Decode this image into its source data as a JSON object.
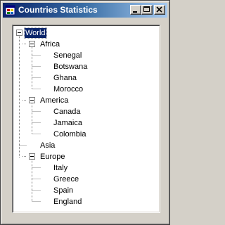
{
  "window": {
    "title": "Countries Statistics",
    "icon": "app-form-icon",
    "buttons": {
      "minimize": "minimize-icon",
      "maximize": "maximize-icon",
      "close": "close-icon"
    }
  },
  "tree": {
    "root": {
      "label": "World",
      "expanded": true,
      "selected": true
    },
    "groups": [
      {
        "label": "Africa",
        "expanded": true,
        "children": [
          "Senegal",
          "Botswana",
          "Ghana",
          "Morocco"
        ]
      },
      {
        "label": "America",
        "expanded": true,
        "children": [
          "Canada",
          "Jamaica",
          "Colombia"
        ]
      },
      {
        "label": "Asia",
        "expanded": false,
        "children": []
      },
      {
        "label": "Europe",
        "expanded": true,
        "children": [
          "Italy",
          "Greece",
          "Spain",
          "England"
        ]
      }
    ]
  },
  "colors": {
    "title_start": "#0a246a",
    "title_end": "#a6caf0",
    "selection": "#0a246a",
    "face": "#d4d0c8"
  }
}
